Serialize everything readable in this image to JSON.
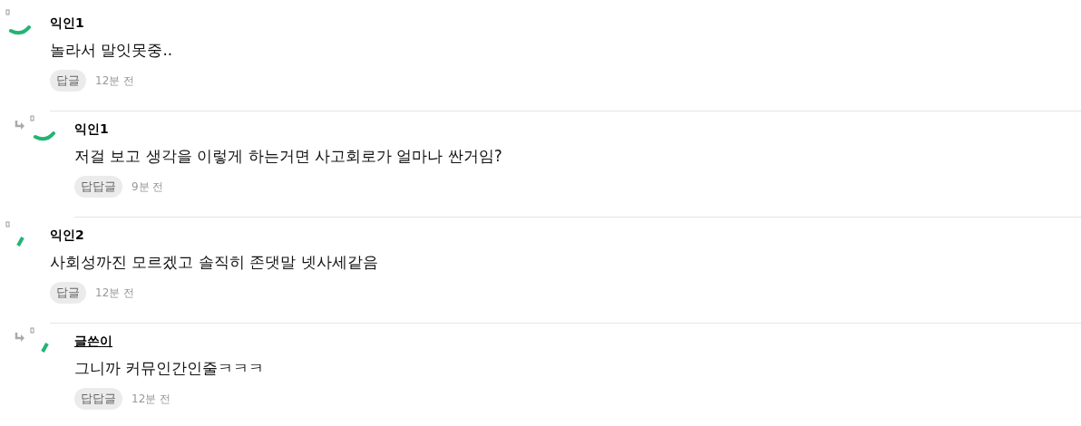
{
  "comments": [
    {
      "is_reply": false,
      "is_author": false,
      "kind": "arc",
      "name": "익인1",
      "body": "놀라서 말잇못중..",
      "reply_button": "답글",
      "time": "12분 전"
    },
    {
      "is_reply": true,
      "is_author": false,
      "kind": "arc",
      "name": "익인1",
      "body": "저걸 보고 생각을 이렇게 하는거면 사고회로가 얼마나 싼거임?",
      "reply_button": "답답글",
      "time": "9분 전"
    },
    {
      "is_reply": false,
      "is_author": false,
      "kind": "stripe",
      "name": "익인2",
      "body": "사회성까진 모르겠고 솔직히 존댓말 넷사세같음",
      "reply_button": "답글",
      "time": "12분 전"
    },
    {
      "is_reply": true,
      "is_author": true,
      "kind": "stripe",
      "name": "글쓴이",
      "body": "그니까 커뮤인간인줄ㅋㅋㅋ",
      "reply_button": "답답글",
      "time": "12분 전"
    }
  ]
}
